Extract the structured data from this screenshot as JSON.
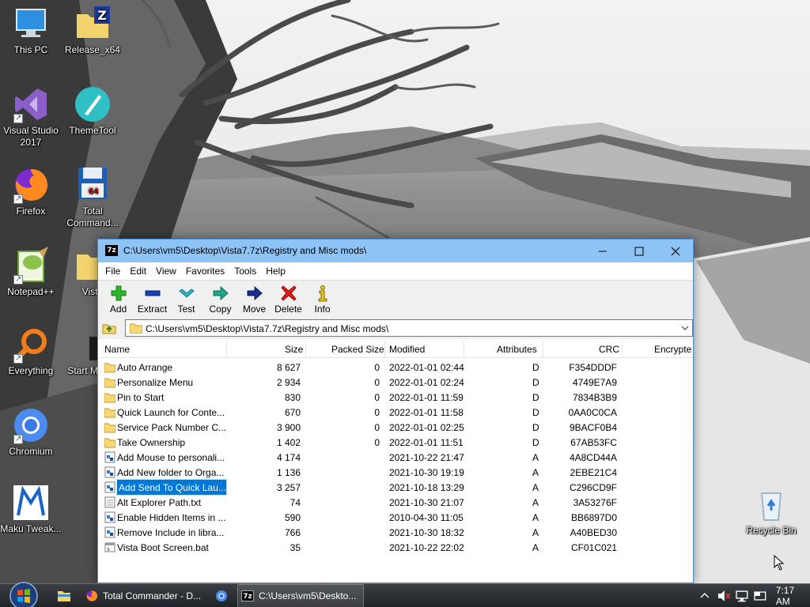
{
  "desktop": {
    "icons": [
      {
        "label": "This PC",
        "icon": "computer-icon"
      },
      {
        "label": "Release_x64",
        "icon": "folder-archive-icon"
      },
      {
        "label": "Visual Studio 2017",
        "icon": "visual-studio-icon"
      },
      {
        "label": "ThemeTool",
        "icon": "themetool-icon"
      },
      {
        "label": "Firefox",
        "icon": "firefox-icon"
      },
      {
        "label": "Total Command...",
        "icon": "total-commander-icon"
      },
      {
        "label": "Notepad++",
        "icon": "notepadpp-icon"
      },
      {
        "label": "Vista",
        "icon": "folder-icon"
      },
      {
        "label": "Everything",
        "icon": "everything-search-icon"
      },
      {
        "label": "Start M Butt",
        "icon": "app-icon"
      },
      {
        "label": "Chromium",
        "icon": "chromium-icon"
      },
      {
        "label": "Maku Tweak...",
        "icon": "maku-tweaker-icon"
      },
      {
        "label": "Recycle Bin",
        "icon": "recycle-bin-icon"
      }
    ]
  },
  "window": {
    "app_icon_text": "7z",
    "title": "C:\\Users\\vm5\\Desktop\\Vista7.7z\\Registry and Misc mods\\",
    "menu": [
      "File",
      "Edit",
      "View",
      "Favorites",
      "Tools",
      "Help"
    ],
    "toolbar": [
      {
        "label": "Add",
        "icon": "add-plus-icon"
      },
      {
        "label": "Extract",
        "icon": "extract-minus-icon"
      },
      {
        "label": "Test",
        "icon": "test-check-icon"
      },
      {
        "label": "Copy",
        "icon": "copy-arrow-icon"
      },
      {
        "label": "Move",
        "icon": "move-arrow-icon"
      },
      {
        "label": "Delete",
        "icon": "delete-x-icon"
      },
      {
        "label": "Info",
        "icon": "info-icon"
      }
    ],
    "address": "C:\\Users\\vm5\\Desktop\\Vista7.7z\\Registry and Misc mods\\",
    "columns": [
      "Name",
      "Size",
      "Packed Size",
      "Modified",
      "Attributes",
      "CRC",
      "Encrypte"
    ],
    "files": [
      {
        "type": "folder",
        "name": "Auto Arrange",
        "size": "8 627",
        "packed": "0",
        "modified": "2022-01-01 02:44",
        "attr": "D",
        "crc": "F354DDDF"
      },
      {
        "type": "folder",
        "name": "Personalize Menu",
        "size": "2 934",
        "packed": "0",
        "modified": "2022-01-01 02:24",
        "attr": "D",
        "crc": "4749E7A9"
      },
      {
        "type": "folder",
        "name": "Pin to Start",
        "size": "830",
        "packed": "0",
        "modified": "2022-01-01 11:59",
        "attr": "D",
        "crc": "7834B3B9"
      },
      {
        "type": "folder",
        "name": "Quick Launch for Conte...",
        "size": "670",
        "packed": "0",
        "modified": "2022-01-01 11:58",
        "attr": "D",
        "crc": "0AA0C0CA"
      },
      {
        "type": "folder",
        "name": "Service Pack Number C...",
        "size": "3 900",
        "packed": "0",
        "modified": "2022-01-01 02:25",
        "attr": "D",
        "crc": "9BACF0B4"
      },
      {
        "type": "folder",
        "name": "Take Ownership",
        "size": "1 402",
        "packed": "0",
        "modified": "2022-01-01 11:51",
        "attr": "D",
        "crc": "67AB53FC"
      },
      {
        "type": "reg",
        "name": "Add Mouse to personali...",
        "size": "4 174",
        "packed": "",
        "modified": "2021-10-22 21:47",
        "attr": "A",
        "crc": "4A8CD44A"
      },
      {
        "type": "reg",
        "name": "Add New folder to Orga...",
        "size": "1 136",
        "packed": "",
        "modified": "2021-10-30 19:19",
        "attr": "A",
        "crc": "2EBE21C4"
      },
      {
        "type": "reg",
        "name": "Add Send To Quick Lau...",
        "size": "3 257",
        "packed": "",
        "modified": "2021-10-18 13:29",
        "attr": "A",
        "crc": "C296CD9F",
        "selected": true
      },
      {
        "type": "txt",
        "name": "Alt Explorer Path.txt",
        "size": "74",
        "packed": "",
        "modified": "2021-10-30 21:07",
        "attr": "A",
        "crc": "3A53276F"
      },
      {
        "type": "reg",
        "name": "Enable Hidden Items in ...",
        "size": "590",
        "packed": "",
        "modified": "2010-04-30 11:05",
        "attr": "A",
        "crc": "BB6897D0"
      },
      {
        "type": "reg",
        "name": "Remove Include in libra...",
        "size": "766",
        "packed": "",
        "modified": "2021-10-30 18:32",
        "attr": "A",
        "crc": "A40BED30"
      },
      {
        "type": "bat",
        "name": "Vista Boot Screen.bat",
        "size": "35",
        "packed": "",
        "modified": "2021-10-22 22:02",
        "attr": "A",
        "crc": "CF01C021"
      }
    ]
  },
  "taskbar": {
    "items": [
      {
        "label": "",
        "icon": "file-explorer-icon"
      },
      {
        "label": "Total Commander - D...",
        "icon": "firefox-icon"
      },
      {
        "label": "",
        "icon": "chromium-icon"
      },
      {
        "label": "C:\\Users\\vm5\\Deskto...",
        "icon": "7zip-icon"
      }
    ],
    "clock": "7:17 AM"
  },
  "colors": {
    "titlebar": "#8ec3f5",
    "selection": "#0078d7",
    "folder": "#ffd96b"
  }
}
